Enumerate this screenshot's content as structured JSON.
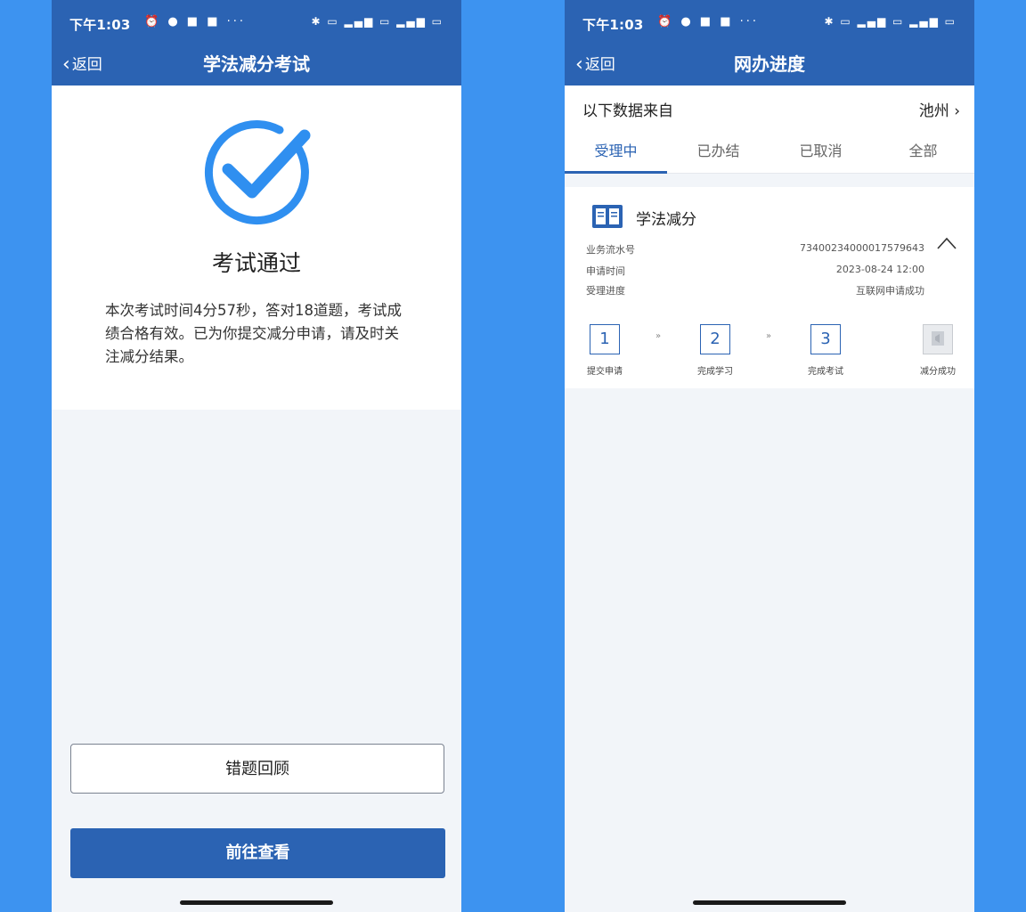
{
  "left": {
    "status": {
      "time": "下午1:03",
      "icons_left": "⏰ ● ■ ■ ···",
      "icons_right": "✱ ▭ ▂▄▆ ▭ ▂▄▆ ▭"
    },
    "nav": {
      "back_label": "返回",
      "title": "学法减分考试"
    },
    "result": {
      "title": "考试通过",
      "description": "本次考试时间4分57秒，答对18道题，考试成绩合格有效。已为你提交减分申请，请及时关注减分结果。"
    },
    "buttons": {
      "review_label": "错题回顾",
      "view_label": "前往查看"
    }
  },
  "right": {
    "status": {
      "time": "下午1:03",
      "icons_left": "⏰ ● ■ ■ ···",
      "icons_right": "✱ ▭ ▂▄▆ ▭ ▂▄▆ ▭"
    },
    "nav": {
      "back_label": "返回",
      "title": "网办进度"
    },
    "source": {
      "label": "以下数据来自",
      "city": "池州"
    },
    "tabs": [
      {
        "label": "受理中",
        "active": true
      },
      {
        "label": "已办结",
        "active": false
      },
      {
        "label": "已取消",
        "active": false
      },
      {
        "label": "全部",
        "active": false
      }
    ],
    "card": {
      "title": "学法减分",
      "rows": [
        {
          "key": "业务流水号",
          "value": "734002340000175796​43"
        },
        {
          "key": "申请时间",
          "value": "2023-08-24 12:00"
        },
        {
          "key": "受理进度",
          "value": "互联网申请成功"
        }
      ],
      "steps": [
        {
          "number": "1",
          "label": "提交申请",
          "done": true
        },
        {
          "number": "2",
          "label": "完成学习",
          "done": true
        },
        {
          "number": "3",
          "label": "完成考试",
          "done": true
        },
        {
          "number": "",
          "label": "减分成功",
          "done": false
        }
      ]
    }
  },
  "colors": {
    "primary": "#2b63b3",
    "background": "#3d93f0",
    "check": "#2f8ff0"
  }
}
